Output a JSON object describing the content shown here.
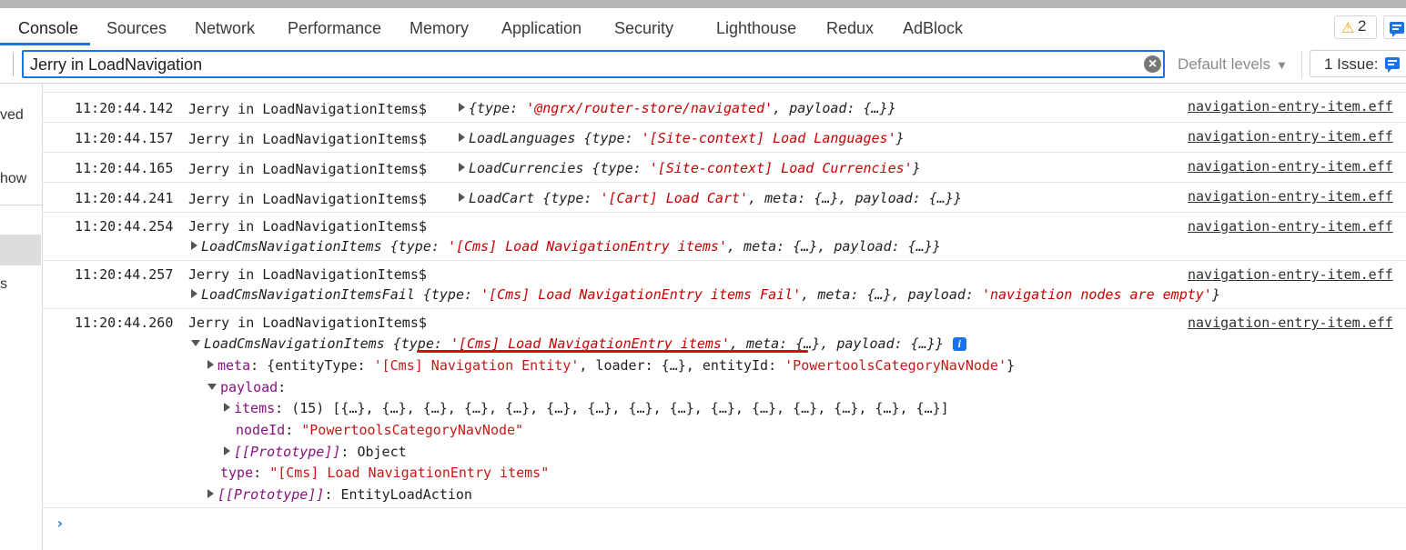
{
  "tabs": [
    "Console",
    "Sources",
    "Network",
    "Performance",
    "Memory",
    "Application",
    "Security",
    "Lighthouse",
    "Redux",
    "AdBlock"
  ],
  "active_tab": "Console",
  "warnings_count": "2",
  "filter": {
    "value": "Jerry in LoadNavigation",
    "clear_symbol": "×"
  },
  "levels_label": "Default levels",
  "issues_label": "1 Issue:",
  "sidebar_fragments": [
    "ved",
    "how",
    "s"
  ],
  "source_link": "navigation-entry-item.eff",
  "prompt_symbol": "›",
  "messages": [
    {
      "time": "11:20:44.142",
      "prefix": "Jerry in LoadNavigationItems$",
      "open": "{",
      "k1": "type",
      "v1": "'@ngrx/router-store/navigated'",
      "sep": ", ",
      "k2": "payload",
      "v2": "{…}",
      "close": "}"
    },
    {
      "time": "11:20:44.157",
      "prefix": "Jerry in LoadNavigationItems$",
      "name": "LoadLanguages",
      "k1": "type",
      "v1": "'[Site-context] Load Languages'"
    },
    {
      "time": "11:20:44.165",
      "prefix": "Jerry in LoadNavigationItems$",
      "name": "LoadCurrencies",
      "k1": "type",
      "v1": "'[Site-context] Load Currencies'"
    },
    {
      "time": "11:20:44.241",
      "prefix": "Jerry in LoadNavigationItems$",
      "name": "LoadCart",
      "k1": "type",
      "v1": "'[Cart] Load Cart'",
      "k2": "meta",
      "v2": "{…}",
      "k3": "payload",
      "v3": "{…}"
    },
    {
      "time": "11:20:44.254",
      "prefix": "Jerry in LoadNavigationItems$",
      "name": "LoadCmsNavigationItems",
      "k1": "type",
      "v1": "'[Cms] Load NavigationEntry items'",
      "k2": "meta",
      "v2": "{…}",
      "k3": "payload",
      "v3": "{…}"
    },
    {
      "time": "11:20:44.257",
      "prefix": "Jerry in LoadNavigationItems$",
      "name": "LoadCmsNavigationItemsFail",
      "k1": "type",
      "v1": "'[Cms] Load NavigationEntry items Fail'",
      "k2": "meta",
      "v2": "{…}",
      "k3": "payload",
      "v3": "'navigation nodes are empty'"
    },
    {
      "time": "11:20:44.260",
      "prefix": "Jerry in LoadNavigationItems$",
      "name": "LoadCmsNavigationItems",
      "k1": "type",
      "v1": "'[Cms] Load NavigationEntry items'",
      "k2": "meta",
      "v2": "{…}",
      "k3": "payload",
      "v3": "{…}",
      "info": "i",
      "tree": {
        "meta_key": "meta",
        "meta_open": "{entityType: ",
        "meta_entity_type": "'[Cms] Navigation Entity'",
        "meta_mid": ", loader: {…}, entityId: ",
        "meta_entity_id": "'PowertoolsCategoryNavNode'",
        "meta_close": "}",
        "payload_key": "payload",
        "items_key": "items",
        "items_value": "(15) [{…}, {…}, {…}, {…}, {…}, {…}, {…}, {…}, {…}, {…}, {…}, {…}, {…}, {…}, {…}]",
        "nodeid_key": "nodeId",
        "nodeid_value": "\"PowertoolsCategoryNavNode\"",
        "proto_key": "[[Prototype]]",
        "proto_value": "Object",
        "type_key": "type",
        "type_value": "\"[Cms] Load NavigationEntry items\"",
        "proto2_key": "[[Prototype]]",
        "proto2_value": "EntityLoadAction"
      }
    }
  ]
}
